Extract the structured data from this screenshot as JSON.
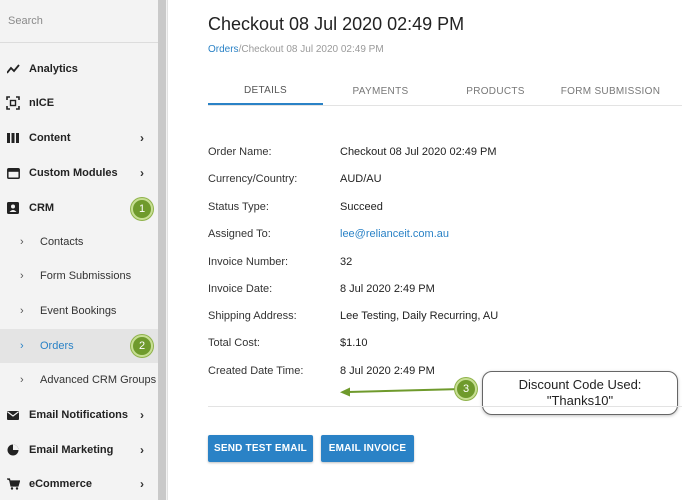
{
  "sidebar": {
    "search_placeholder": "Search",
    "items": [
      {
        "label": "Analytics"
      },
      {
        "label": "nICE"
      },
      {
        "label": "Content"
      },
      {
        "label": "Custom Modules"
      },
      {
        "label": "CRM"
      },
      {
        "label": "Email Notifications"
      },
      {
        "label": "Email Marketing"
      },
      {
        "label": "eCommerce"
      }
    ],
    "crm_children": [
      {
        "label": "Contacts"
      },
      {
        "label": "Form Submissions"
      },
      {
        "label": "Event Bookings"
      },
      {
        "label": "Orders"
      },
      {
        "label": "Advanced CRM Groups"
      }
    ]
  },
  "annotations": {
    "badge1": "1",
    "badge2": "2",
    "badge3": "3",
    "callout_line1": "Discount Code Used:",
    "callout_line2": "\"Thanks10\""
  },
  "main": {
    "title": "Checkout 08 Jul 2020 02:49 PM",
    "breadcrumb": {
      "link": "Orders",
      "current": "/Checkout 08 Jul 2020 02:49 PM"
    },
    "tabs": [
      {
        "label": "DETAILS"
      },
      {
        "label": "PAYMENTS"
      },
      {
        "label": "PRODUCTS"
      },
      {
        "label": "FORM SUBMISSION"
      }
    ],
    "fields": [
      {
        "label": "Order Name:",
        "value": "Checkout 08 Jul 2020 02:49 PM"
      },
      {
        "label": "Currency/Country:",
        "value": "AUD/AU"
      },
      {
        "label": "Status Type:",
        "value": "Succeed"
      },
      {
        "label": "Assigned To:",
        "value": "lee@relianceit.com.au"
      },
      {
        "label": "Invoice Number:",
        "value": "32"
      },
      {
        "label": "Invoice Date:",
        "value": "8 Jul 2020 2:49 PM"
      },
      {
        "label": "Shipping Address:",
        "value": "Lee Testing, Daily Recurring, AU"
      },
      {
        "label": "Total Cost:",
        "value": "$1.10"
      },
      {
        "label": "Created Date Time:",
        "value": "8 Jul 2020 2:49 PM"
      }
    ],
    "buttons": {
      "send_test_email": "SEND TEST EMAIL",
      "email_invoice": "EMAIL INVOICE"
    }
  },
  "colors": {
    "accent": "#2a82c6",
    "badge": "#6f9a2c",
    "sidebar_bg": "#f3f3f3"
  }
}
